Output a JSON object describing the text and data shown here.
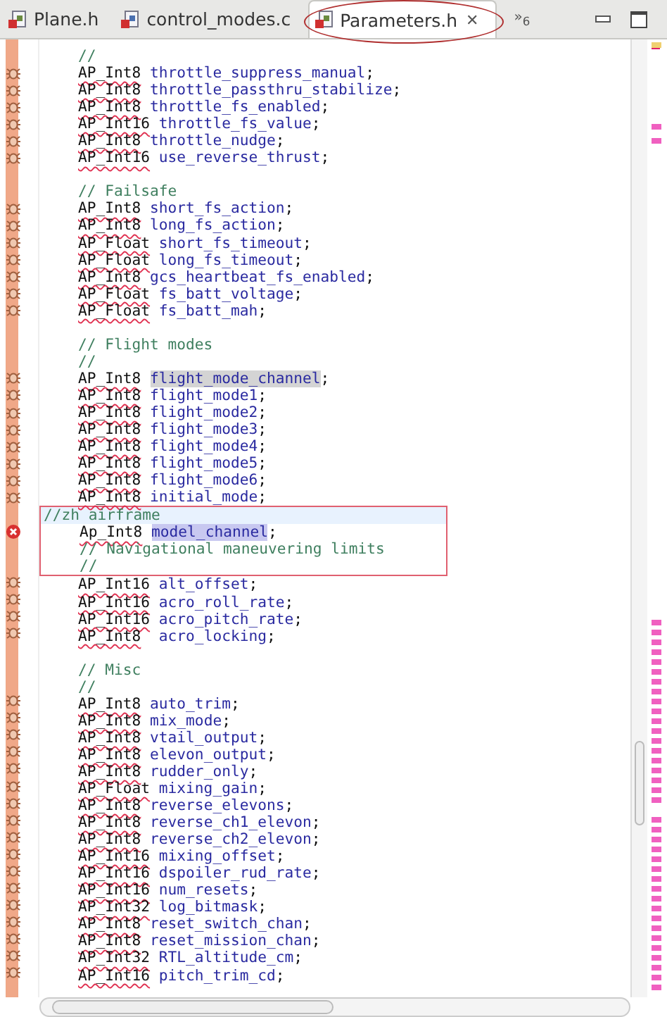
{
  "tabs": [
    {
      "label": "Plane.h",
      "source": false,
      "selected": false,
      "circled": false
    },
    {
      "label": "control_modes.c",
      "source": true,
      "selected": false,
      "circled": false
    },
    {
      "label": "Parameters.h",
      "source": false,
      "selected": true,
      "circled": true,
      "close": "✕"
    }
  ],
  "overflow": "»$_{6}$",
  "lines": [
    {
      "kind": "comment",
      "text": "    //"
    },
    {
      "kind": "decl",
      "type": "AP_Int8",
      "name": "throttle_suppress_manual",
      "end": ";",
      "warning": true
    },
    {
      "kind": "decl",
      "type": "AP_Int8",
      "name": "throttle_passthru_stabilize",
      "end": ";",
      "warning": true
    },
    {
      "kind": "decl",
      "type": "AP_Int8",
      "name": "throttle_fs_enabled",
      "end": ";",
      "warning": true
    },
    {
      "kind": "decl",
      "type": "AP_Int16",
      "name": "throttle_fs_value",
      "end": ";",
      "warning": true
    },
    {
      "kind": "decl",
      "type": "AP_Int8",
      "name": "throttle_nudge",
      "end": ";",
      "warning": true
    },
    {
      "kind": "decl",
      "type": "AP_Int16",
      "name": "use_reverse_thrust",
      "end": ";",
      "warning": true
    },
    {
      "kind": "blank"
    },
    {
      "kind": "comment",
      "text": "    // Failsafe"
    },
    {
      "kind": "decl",
      "type": "AP_Int8",
      "name": "short_fs_action",
      "end": ";",
      "warning": true
    },
    {
      "kind": "decl",
      "type": "AP_Int8",
      "name": "long_fs_action",
      "end": ";",
      "warning": true
    },
    {
      "kind": "decl",
      "type": "AP_Float",
      "name": "short_fs_timeout",
      "end": ";",
      "warning": true
    },
    {
      "kind": "decl",
      "type": "AP_Float",
      "name": "long_fs_timeout",
      "end": ";",
      "warning": true
    },
    {
      "kind": "decl",
      "type": "AP_Int8",
      "name": "gcs_heartbeat_fs_enabled",
      "end": ";",
      "warning": true
    },
    {
      "kind": "decl",
      "type": "AP_Float",
      "name": "fs_batt_voltage",
      "end": ";",
      "warning": true
    },
    {
      "kind": "decl",
      "type": "AP_Float",
      "name": "fs_batt_mah",
      "end": ";",
      "warning": true
    },
    {
      "kind": "blank"
    },
    {
      "kind": "comment",
      "text": "    // Flight modes"
    },
    {
      "kind": "comment",
      "text": "    //"
    },
    {
      "kind": "decl",
      "type": "AP_Int8",
      "name": "flight_mode_channel",
      "end": ";",
      "warning": true,
      "occurrence": true
    },
    {
      "kind": "decl",
      "type": "AP_Int8",
      "name": "flight_mode1",
      "end": ";",
      "warning": true
    },
    {
      "kind": "decl",
      "type": "AP_Int8",
      "name": "flight_mode2",
      "end": ";",
      "warning": true
    },
    {
      "kind": "decl",
      "type": "AP_Int8",
      "name": "flight_mode3",
      "end": ";",
      "warning": true
    },
    {
      "kind": "decl",
      "type": "AP_Int8",
      "name": "flight_mode4",
      "end": ";",
      "warning": true
    },
    {
      "kind": "decl",
      "type": "AP_Int8",
      "name": "flight_mode5",
      "end": ";",
      "warning": true
    },
    {
      "kind": "decl",
      "type": "AP_Int8",
      "name": "flight_mode6",
      "end": ";",
      "warning": true
    },
    {
      "kind": "decl",
      "type": "AP_Int8",
      "name": "initial_mode",
      "end": ";",
      "warning": true
    },
    {
      "kind": "comment",
      "text": "//zh airframe",
      "current": true,
      "boxed": true
    },
    {
      "kind": "decl",
      "type": "Ap_Int8",
      "name": "model_channel",
      "end": ";",
      "error": true,
      "selection": true,
      "boxed": true
    },
    {
      "kind": "comment",
      "text": "    // Navigational maneuvering limits",
      "boxed": true
    },
    {
      "kind": "comment",
      "text": "    //",
      "boxed": true
    },
    {
      "kind": "decl",
      "type": "AP_Int16",
      "name": "alt_offset",
      "end": ";",
      "warning": true
    },
    {
      "kind": "decl",
      "type": "AP_Int16",
      "name": "acro_roll_rate",
      "end": ";",
      "warning": true
    },
    {
      "kind": "decl",
      "type": "AP_Int16",
      "name": "acro_pitch_rate",
      "end": ";",
      "warning": true
    },
    {
      "kind": "decl",
      "type": "AP_Int8",
      "name": " acro_locking",
      "end": ";",
      "warning": true
    },
    {
      "kind": "blank"
    },
    {
      "kind": "comment",
      "text": "    // Misc"
    },
    {
      "kind": "comment",
      "text": "    //"
    },
    {
      "kind": "decl",
      "type": "AP_Int8",
      "name": "auto_trim",
      "end": ";",
      "warning": true
    },
    {
      "kind": "decl",
      "type": "AP_Int8",
      "name": "mix_mode",
      "end": ";",
      "warning": true
    },
    {
      "kind": "decl",
      "type": "AP_Int8",
      "name": "vtail_output",
      "end": ";",
      "warning": true
    },
    {
      "kind": "decl",
      "type": "AP_Int8",
      "name": "elevon_output",
      "end": ";",
      "warning": true
    },
    {
      "kind": "decl",
      "type": "AP_Int8",
      "name": "rudder_only",
      "end": ";",
      "warning": true
    },
    {
      "kind": "decl",
      "type": "AP_Float",
      "name": "mixing_gain",
      "end": ";",
      "warning": true
    },
    {
      "kind": "decl",
      "type": "AP_Int8",
      "name": "reverse_elevons",
      "end": ";",
      "warning": true
    },
    {
      "kind": "decl",
      "type": "AP_Int8",
      "name": "reverse_ch1_elevon",
      "end": ";",
      "warning": true
    },
    {
      "kind": "decl",
      "type": "AP_Int8",
      "name": "reverse_ch2_elevon",
      "end": ";",
      "warning": true
    },
    {
      "kind": "decl",
      "type": "AP_Int16",
      "name": "mixing_offset",
      "end": ";",
      "warning": true
    },
    {
      "kind": "decl",
      "type": "AP_Int16",
      "name": "dspoiler_rud_rate",
      "end": ";",
      "warning": true
    },
    {
      "kind": "decl",
      "type": "AP_Int16",
      "name": "num_resets",
      "end": ";",
      "warning": true
    },
    {
      "kind": "decl",
      "type": "AP_Int32",
      "name": "log_bitmask",
      "end": ";",
      "warning": true
    },
    {
      "kind": "decl",
      "type": "AP_Int8",
      "name": "reset_switch_chan",
      "end": ";",
      "warning": true
    },
    {
      "kind": "decl",
      "type": "AP_Int8",
      "name": "reset_mission_chan",
      "end": ";",
      "warning": true
    },
    {
      "kind": "decl",
      "type": "AP_Int32",
      "name": "RTL_altitude_cm",
      "end": ";",
      "warning": true
    },
    {
      "kind": "decl",
      "type": "AP_Int16",
      "name": "pitch_trim_cd",
      "end": ";",
      "warning": true
    }
  ]
}
